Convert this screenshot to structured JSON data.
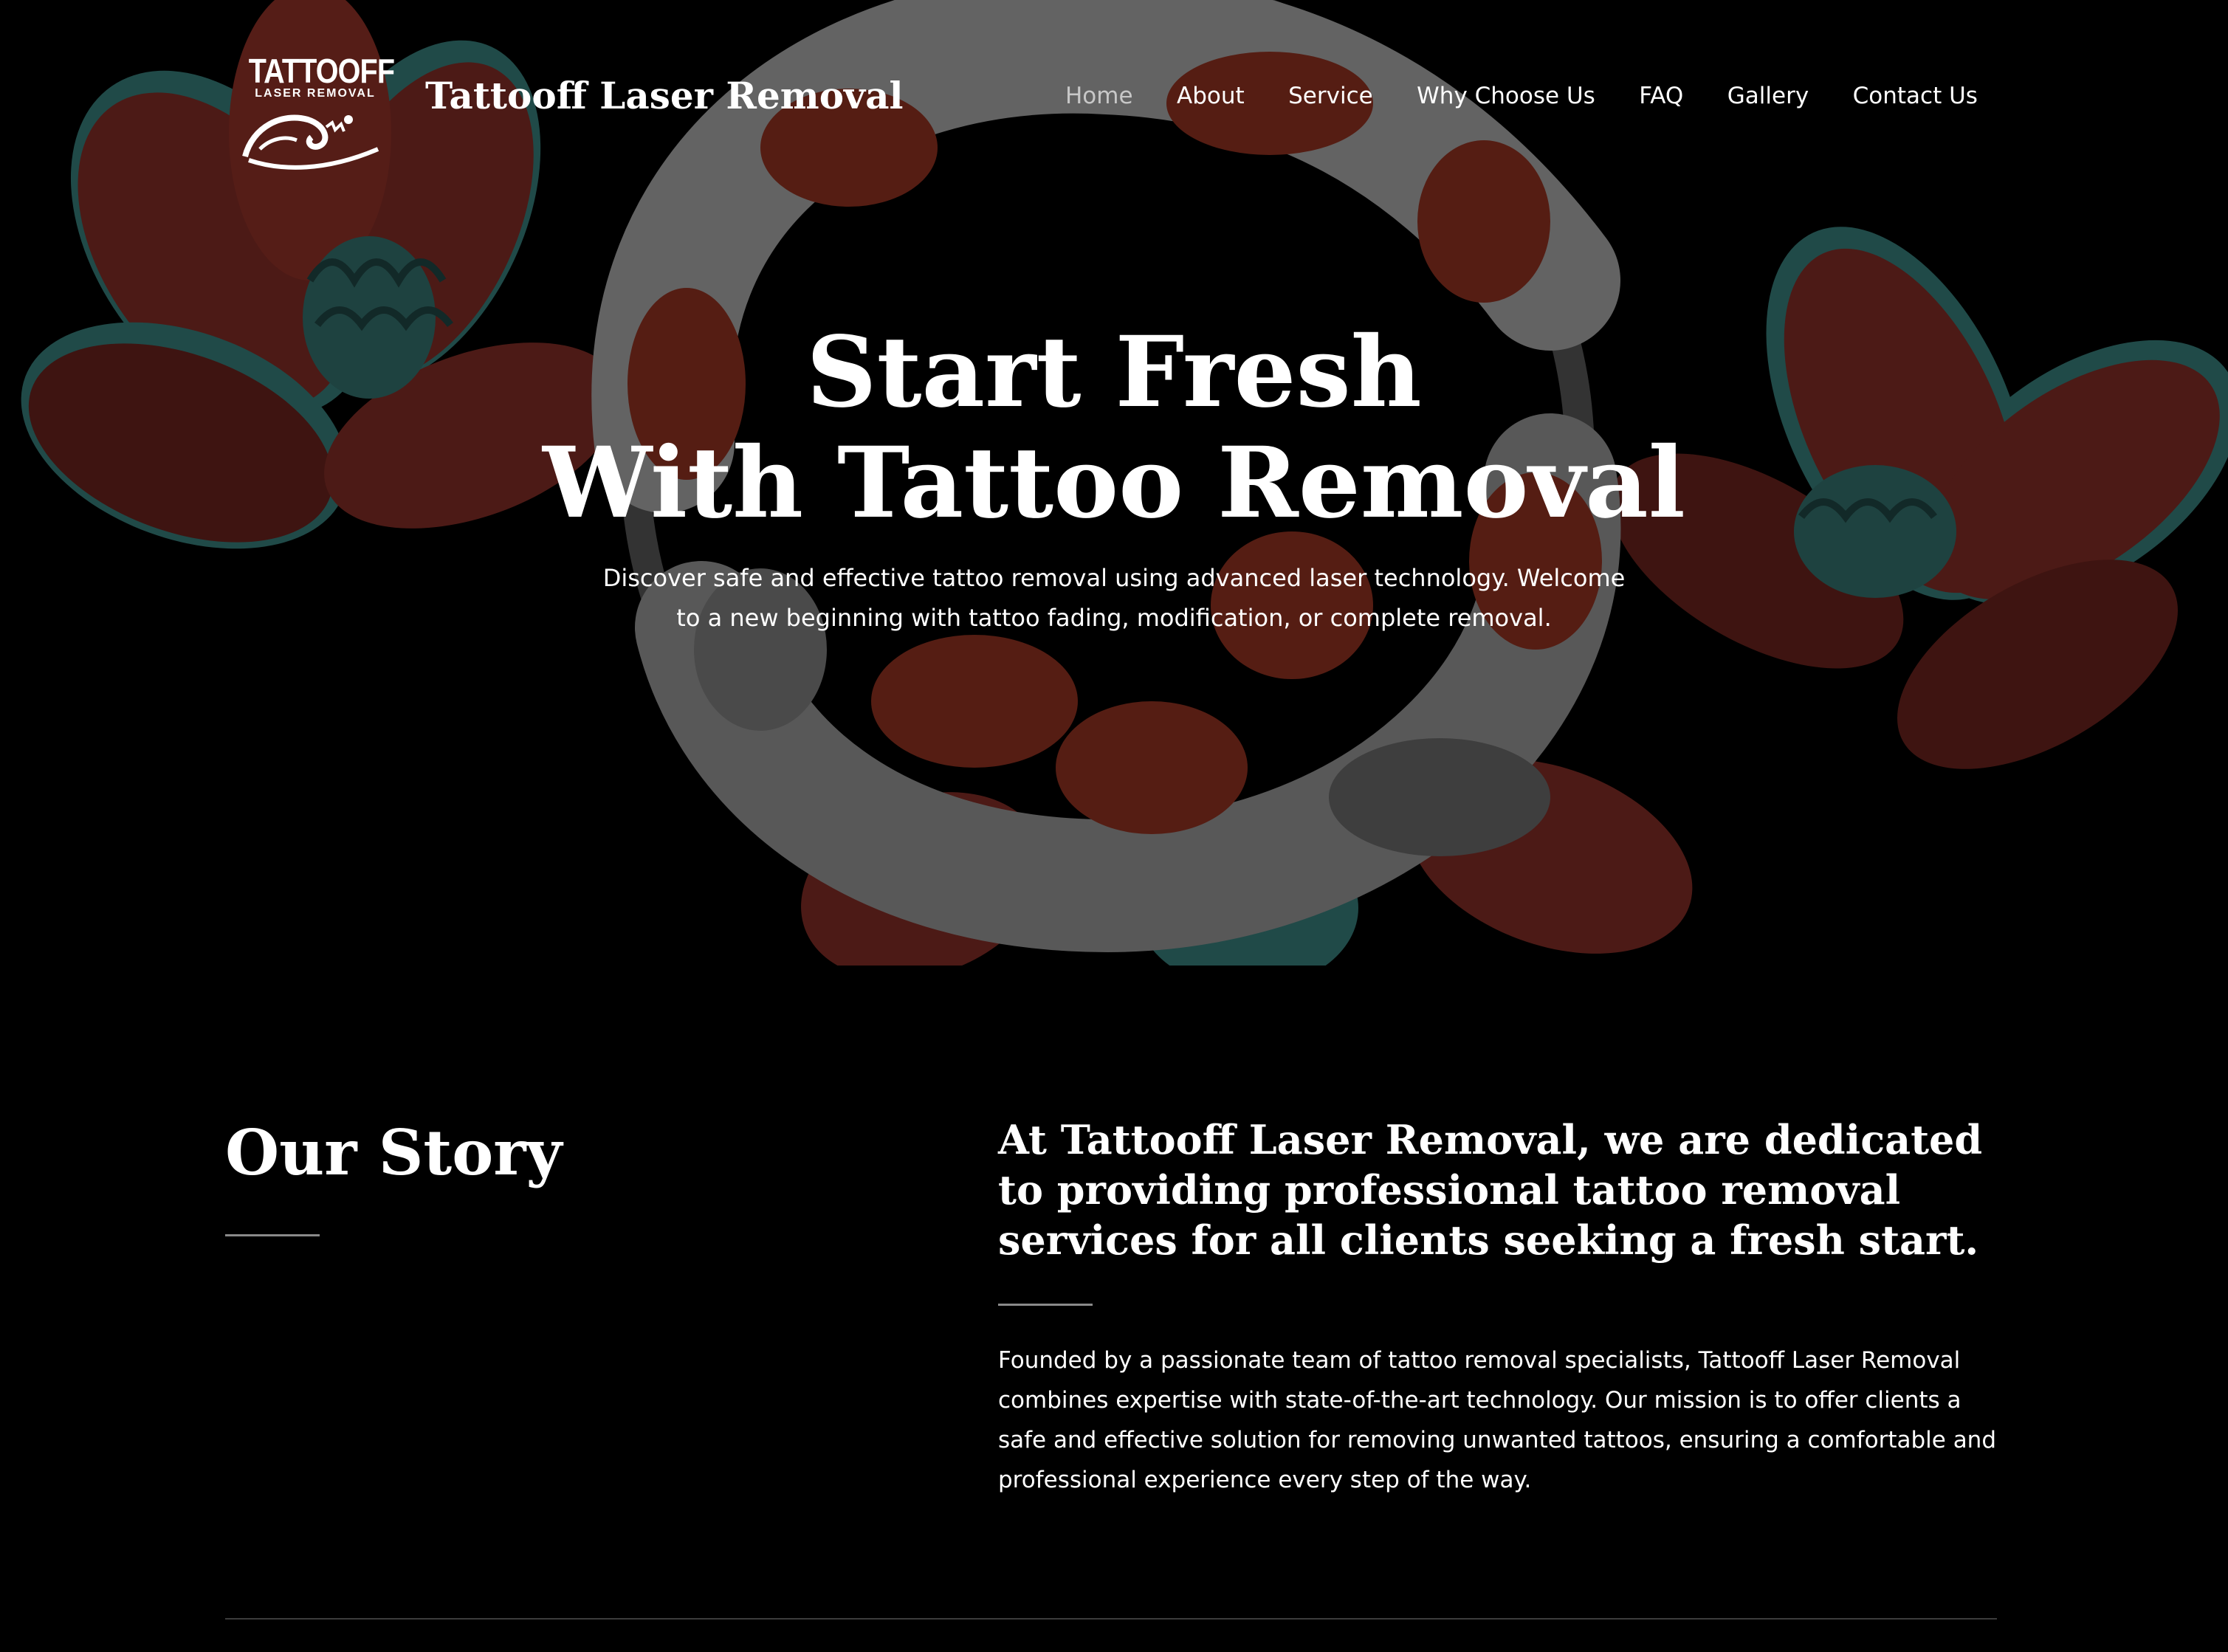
{
  "brand": {
    "logo_word": "TATTOOFF",
    "logo_sub": "LASER REMOVAL",
    "site_title": "Tattooff Laser Removal"
  },
  "nav": {
    "items": [
      {
        "label": "Home",
        "active": true
      },
      {
        "label": "About"
      },
      {
        "label": "Service"
      },
      {
        "label": "Why Choose Us"
      },
      {
        "label": "FAQ"
      },
      {
        "label": "Gallery"
      },
      {
        "label": "Contact Us"
      }
    ]
  },
  "hero": {
    "title_line1": "Start Fresh",
    "title_line2": "With Tattoo Removal",
    "subtitle": "Discover safe and effective tattoo removal using advanced laser technology. Welcome to a new beginning with tattoo fading, modification, or complete removal."
  },
  "story": {
    "heading": "Our Story",
    "lead": "At Tattooff Laser Removal, we are dedicated to providing professional tattoo removal services for all clients seeking a fresh start.",
    "body": "Founded by a passionate team of tattoo removal specialists, Tattooff Laser Removal combines expertise with state-of-the-art technology. Our mission is to offer clients a safe and effective solution for removing unwanted tattoos, ensuring a comfortable and professional experience every step of the way."
  },
  "colors": {
    "background": "#000000",
    "koi_red": "#7a2a1c",
    "koi_white": "#8e8e8e",
    "lotus_red": "#6e2620",
    "lotus_teal": "#2f6a68",
    "divider": "#8a8a8a"
  }
}
